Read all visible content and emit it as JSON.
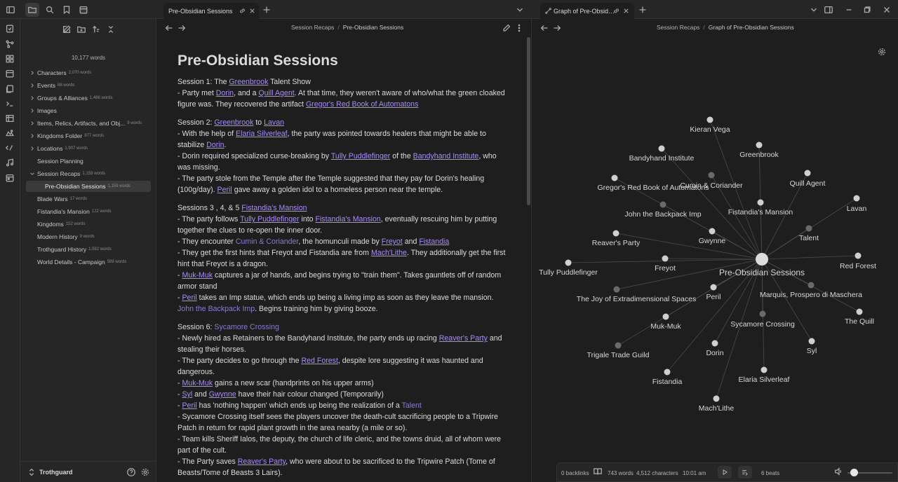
{
  "tabs": {
    "note_tab": "Pre-Obsidian Sessions",
    "graph_tab": "Graph of Pre-Obsid…"
  },
  "sidebar": {
    "word_count": "10,177 words",
    "vault_name": "Trothguard",
    "items": [
      {
        "label": "Characters",
        "count": "2,070 words"
      },
      {
        "label": "Events",
        "count": "88 words"
      },
      {
        "label": "Groups & Alliances",
        "count": "1,486 words"
      },
      {
        "label": "Images",
        "count": ""
      },
      {
        "label": "Items, Relics, Artifacts, and Obj...",
        "count": "9 words"
      },
      {
        "label": "Kingdoms Folder",
        "count": "977 words"
      },
      {
        "label": "Locations",
        "count": "1,907 words"
      },
      {
        "label": "Session Planning",
        "count": ""
      },
      {
        "label": "Session Recaps",
        "count": "1,159 words"
      },
      {
        "label": "Pre-Obsidian Sessions",
        "count": "1,159 words"
      },
      {
        "label": "Blade Wars",
        "count": "17 words"
      },
      {
        "label": "Fistandia's Mansion",
        "count": "122 words"
      },
      {
        "label": "Kingdoms",
        "count": "152 words"
      },
      {
        "label": "Modern History",
        "count": "9 words"
      },
      {
        "label": "Trothguard History",
        "count": "1,592 words"
      },
      {
        "label": "World Details - Campaign",
        "count": "589 words"
      }
    ]
  },
  "note": {
    "breadcrumb_parent": "Session Recaps",
    "breadcrumb_current": "Pre-Obsidian Sessions",
    "title": "Pre-Obsidian Sessions",
    "p1": {
      "a": "Session 1: The ",
      "l1": "Greenbrook",
      "b": " Talent Show",
      "c": "- Party met ",
      "l2": "Dorin",
      "d": ", and a ",
      "l3": "Quill Agent",
      "e": ". At that time, they weren't aware of who/what the green cloaked figure was. They recovered the artifact ",
      "l4": "Gregor's Red Book of Automatons"
    },
    "p2": {
      "a": "Session 2: ",
      "l1": "Greenbrook",
      "b": " to ",
      "l2": "Lavan",
      "c": "- With the help of ",
      "l3": "Elaria Silverleaf",
      "d": ", the party was pointed towards healers that might be able to stabilize ",
      "l4": "Dorin",
      "e": ".",
      "f": "- Dorin required specialized curse-breaking by ",
      "l5": "Tully Puddlefinger",
      "g": " of the ",
      "l6": "Bandyhand Institute",
      "h": ", who was missing.",
      "i": "- The party stole from the Temple after the Temple suggested that they pay for Dorin's healing (100g/day). ",
      "l7": "Peril",
      "j": " gave away a golden idol to a homeless person near the temple."
    },
    "p3": {
      "a": "Sessions 3 , 4, & 5 ",
      "l1": "Fistandia's Mansion",
      "b": "- The party follows ",
      "l2": "Tully Puddlefinger",
      "c": " into ",
      "l3": "Fistandia's Mansion",
      "d": ", eventually rescuing him by putting together the clues to re-open the inner door.",
      "e": "- They encounter ",
      "u1": "Cumin & Coriander",
      "f": ", the homunculi made by ",
      "l4": "Freyot",
      "g": " and ",
      "l5": "Fistandia",
      "h": "- They get the first hints that Freyot and Fistandia are from ",
      "l6": "Mach'Lithe",
      "i": ". They additionally get the first hint that Freyot is a dragon.",
      "j": "- ",
      "l7": "Muk-Muk",
      "k": " captures a jar of hands, and begins trying to \"train them\". Takes gauntlets off of random armor stand",
      "m": "- ",
      "l8": "Peril",
      "n": " takes an Imp statue, which ends up being a living imp as soon as they leave the mansion. ",
      "u2": "John the Backpack Imp",
      "o": ". Begins training him by giving booze."
    },
    "p4": {
      "a": "Session 6: ",
      "u1": "Sycamore Crossing",
      "b": "- Newly hired as Retainers to the Bandyhand Institute, the party ends up racing ",
      "l1": "Reaver's Party",
      "c": " and stealing their horses.",
      "d": "- The party decides to go through the ",
      "l2": "Red Forest",
      "e": ", despite lore suggesting it was haunted and dangerous.",
      "f": "- ",
      "l3": "Muk-Muk",
      "g": " gains a new scar (handprints on his upper arms)",
      "h": "- ",
      "l4": "Syl",
      "i": " and ",
      "l5": "Gwynne",
      "j": " have their hair colour changed (Temporarily)",
      "k": "- ",
      "l6": "Peril",
      "m": " has 'nothing happen' which ends up being the realization of a ",
      "u2": "Talent",
      "n": "- Sycamore Crossing itself sees the players uncover the death-cult sacrificing people to a Tripwire Patch in return for rapid plant growth in the area nearby (a mile or so).",
      "o": "- Team kills Sheriff Ialos, the deputy, the church of life cleric, and the towns druid, all of whom were part of the cult.",
      "q": "- The Party saves ",
      "l7": "Reaver's Party",
      "r": ", who were about to be sacrificed to the Tripwire Patch (Tome of Beasts/Tome of Beasts 3 Lairs)."
    }
  },
  "graph": {
    "breadcrumb_parent": "Session Recaps",
    "breadcrumb_current": "Graph of Pre-Obsidian Sessions",
    "center": "Pre-Obsidian Sessions",
    "nodes": [
      {
        "label": "Kieran Vega"
      },
      {
        "label": "Bandyhand Institute"
      },
      {
        "label": "Greenbrook"
      },
      {
        "label": "Cumin & Coriander"
      },
      {
        "label": "Quill Agent"
      },
      {
        "label": "Gregor's Red Book of Automatons"
      },
      {
        "label": "Lavan"
      },
      {
        "label": "Fistandia's Mansion"
      },
      {
        "label": "John the Backpack Imp"
      },
      {
        "label": "Talent"
      },
      {
        "label": "Reaver's Party"
      },
      {
        "label": "Gwynne"
      },
      {
        "label": "Red Forest"
      },
      {
        "label": "Tully Puddlefinger"
      },
      {
        "label": "Freyot"
      },
      {
        "label": "Marquis, Prospero di Maschera"
      },
      {
        "label": "The Joy of Extradimensional Spaces"
      },
      {
        "label": "Peril"
      },
      {
        "label": "The Quill"
      },
      {
        "label": "Muk-Muk"
      },
      {
        "label": "Sycamore Crossing"
      },
      {
        "label": "Syl"
      },
      {
        "label": "Trigale Trade Guild"
      },
      {
        "label": "Dorin"
      },
      {
        "label": "Elaria Silverleaf"
      },
      {
        "label": "Fistandia"
      },
      {
        "label": "Mach'Lithe"
      }
    ]
  },
  "status": {
    "backlinks": "0 backlinks",
    "words": "743 words",
    "characters": "4,512 characters",
    "time": "10:01 am",
    "beats": "6 beats"
  },
  "colors": {
    "link": "#a88bfa",
    "unresolved_link": "#8f77d8",
    "background": "#1e1e1e",
    "panel": "#262626"
  }
}
